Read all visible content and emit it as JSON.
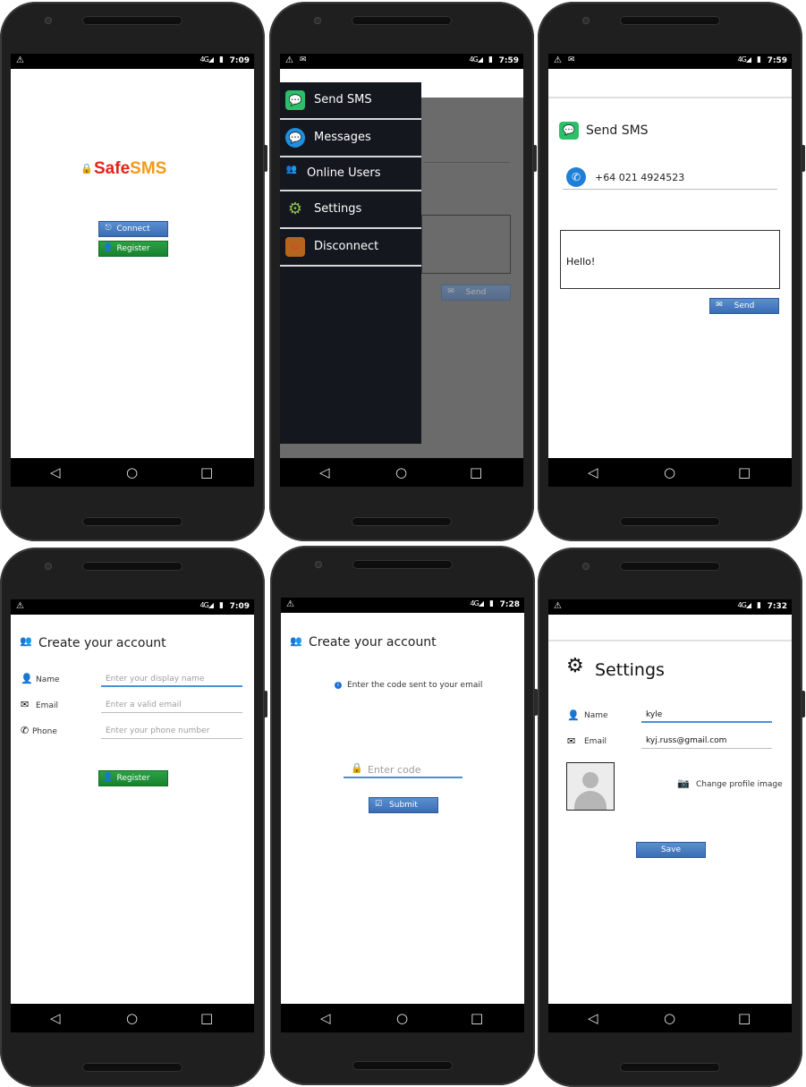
{
  "colors": {
    "brand_red": "#e2231a",
    "brand_orange": "#f39a16",
    "button_blue": "#3b6db4",
    "button_green": "#17822e",
    "drawer_bg": "#15171f",
    "accent_line": "#4a90d9"
  },
  "screens": [
    {
      "status": {
        "time": "7:09",
        "network": "4G"
      },
      "logo": {
        "part1": "Safe",
        "part2": "SMS"
      },
      "buttons": {
        "connect": "Connect",
        "register": "Register"
      }
    },
    {
      "status": {
        "time": "7:59",
        "network": "4G"
      },
      "drawer_items": [
        {
          "label": "Send SMS",
          "icon": "chat-bubbles-icon"
        },
        {
          "label": "Messages",
          "icon": "message-bubble-icon"
        },
        {
          "label": "Online Users",
          "icon": "users-icon"
        },
        {
          "label": "Settings",
          "icon": "gear-icon"
        },
        {
          "label": "Disconnect",
          "icon": "exit-door-icon"
        }
      ],
      "send_label": "Send"
    },
    {
      "status": {
        "time": "7:59",
        "network": "4G"
      },
      "title": "Send SMS",
      "phone_number": "+64 021 4924523",
      "message": "Hello!",
      "send_label": "Send"
    },
    {
      "status": {
        "time": "7:09",
        "network": "4G"
      },
      "title": "Create your account",
      "fields": [
        {
          "label": "Name",
          "placeholder": "Enter your display name"
        },
        {
          "label": "Email",
          "placeholder": "Enter a valid email"
        },
        {
          "label": "Phone",
          "placeholder": "Enter your phone number"
        }
      ],
      "register_label": "Register"
    },
    {
      "status": {
        "time": "7:28",
        "network": "4G"
      },
      "title": "Create your account",
      "info": "Enter the code sent to your email",
      "code_placeholder": "Enter code",
      "submit_label": "Submit"
    },
    {
      "status": {
        "time": "7:32",
        "network": "4G"
      },
      "title": "Settings",
      "name_label": "Name",
      "name_value": "kyle",
      "email_label": "Email",
      "email_value": "kyj.russ@gmail.com",
      "change_image": "Change profile image",
      "save_label": "Save"
    }
  ]
}
